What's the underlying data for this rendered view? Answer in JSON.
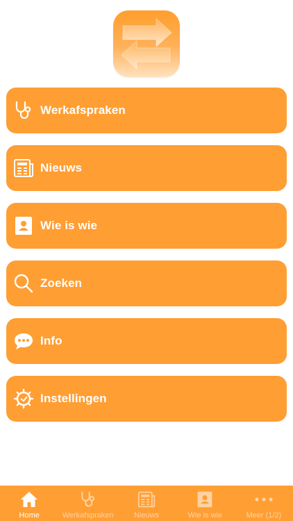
{
  "colors": {
    "accent": "#ff9e33",
    "text_on_accent": "#ffffff",
    "tab_inactive": "#ffd2a0"
  },
  "app_logo": {
    "icon": "swap-arrows-icon"
  },
  "menu": [
    {
      "label": "Werkafspraken",
      "icon": "stethoscope-icon"
    },
    {
      "label": "Nieuws",
      "icon": "newspaper-icon"
    },
    {
      "label": "Wie is wie",
      "icon": "contact-card-icon"
    },
    {
      "label": "Zoeken",
      "icon": "search-icon"
    },
    {
      "label": "Info",
      "icon": "chat-bubble-icon"
    },
    {
      "label": "Instellingen",
      "icon": "gear-icon"
    }
  ],
  "tabbar": [
    {
      "label": "Home",
      "icon": "home-icon",
      "active": true
    },
    {
      "label": "Werkafspraken",
      "icon": "stethoscope-icon",
      "active": false
    },
    {
      "label": "Nieuws",
      "icon": "newspaper-icon",
      "active": false
    },
    {
      "label": "Wie is wie",
      "icon": "contact-card-icon",
      "active": false
    },
    {
      "label": "Meer (1/2)",
      "icon": "more-dots-icon",
      "active": false
    }
  ]
}
